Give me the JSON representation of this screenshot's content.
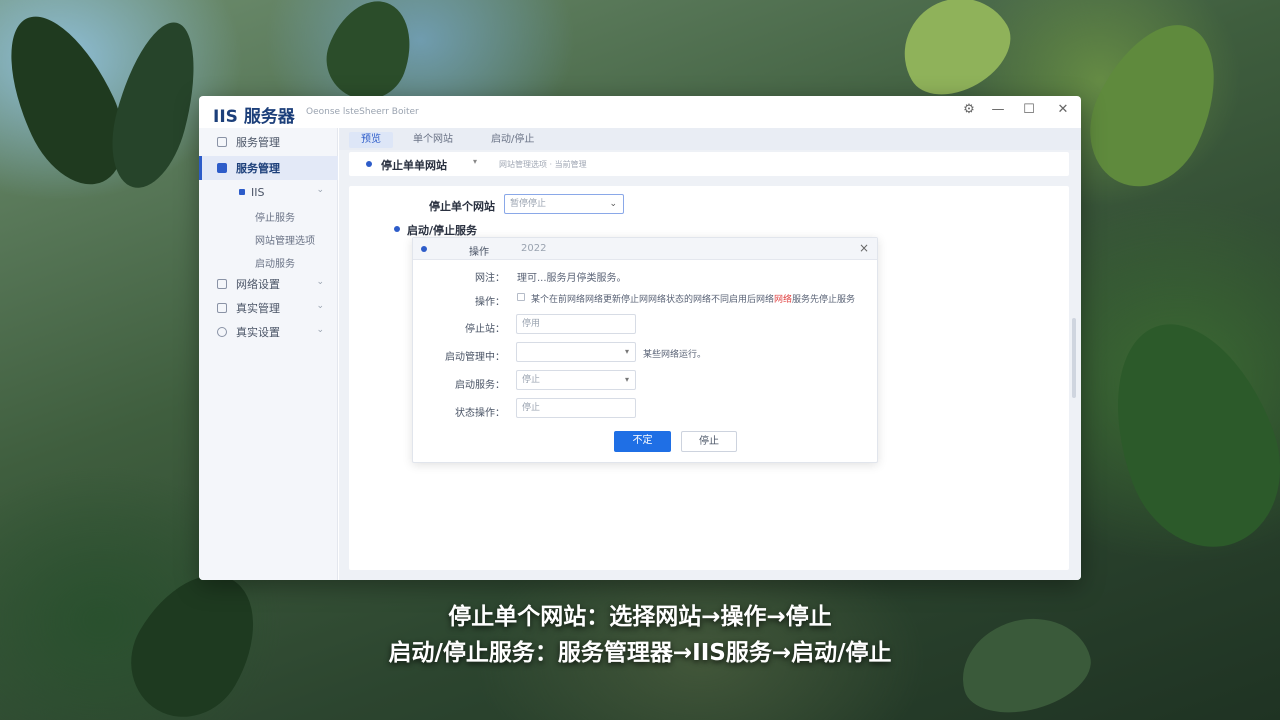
{
  "app": {
    "title": "IIS 服务器",
    "subtitle": "Oeonse lsteSheerr Boiter"
  },
  "window_controls": {
    "settings": "⚙",
    "minimize": "—",
    "maximize": "☐",
    "close": "✕"
  },
  "sidebar": {
    "items": [
      {
        "label": "服务管理"
      },
      {
        "label": "服务管理"
      },
      {
        "label": "IIS"
      },
      {
        "label": "网络设置"
      },
      {
        "label": "真实管理"
      },
      {
        "label": "真实设置"
      }
    ],
    "sub_items": [
      "停止服务",
      "网站管理选项",
      "启动服务"
    ]
  },
  "tabs": [
    "预览",
    "单个网站",
    "启动/停止"
  ],
  "crumb": {
    "title": "停止单单网站",
    "hint": "网站管理选项 · 当前管理"
  },
  "content": {
    "stop_site_label": "停止单个网站",
    "stop_site_select": "暂停停止",
    "start_stop_heading": "启动/停止服务"
  },
  "dialog": {
    "title": "操作",
    "title_value": "2022",
    "close": "×",
    "note_label": "网注：",
    "note_text": "理可...服务月停类服务。",
    "action_label": "操作：",
    "action_text_a": "某个在前网络网络更新停止网网络状态的网络不同启用后网络",
    "action_text_red": "网络",
    "action_text_b": "服务先停止服务",
    "site_label": "停止站：",
    "site_value": "停用",
    "manager_label": "启动管理中：",
    "manager_value": "",
    "manager_hint": "某些网络运行。",
    "start_label": "启动服务：",
    "start_value": "停止",
    "status_label": "状态操作：",
    "status_value": "停止",
    "primary_button": "不定",
    "secondary_button": "停止"
  },
  "captions": {
    "line1": "停止单个网站：选择网站→操作→停止",
    "line2": "启动/停止服务：服务管理器→IIS服务→启动/停止"
  }
}
